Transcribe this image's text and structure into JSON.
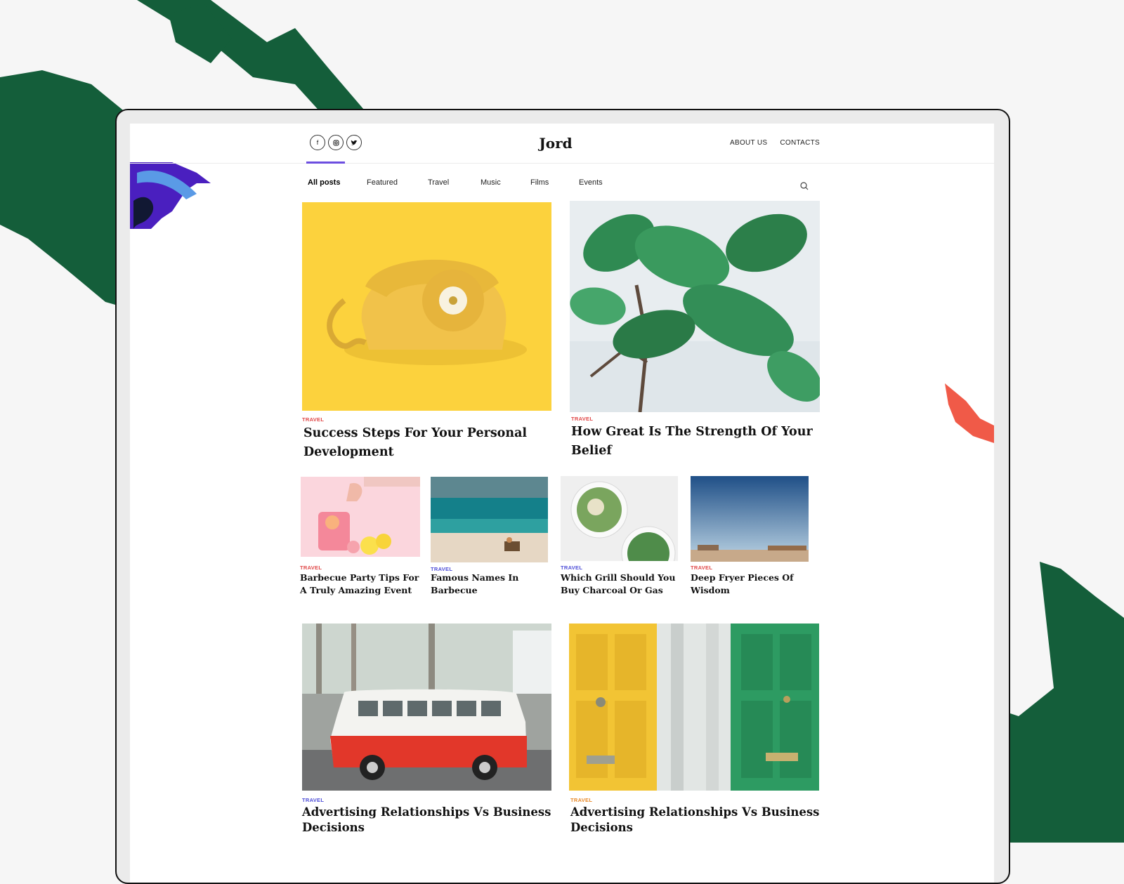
{
  "site": {
    "logo": "Jord",
    "top_links": [
      "ABOUT US",
      "CONTACTS"
    ],
    "social_icons": [
      "facebook-icon",
      "instagram-icon",
      "twitter-icon"
    ]
  },
  "nav": {
    "categories": [
      "All posts",
      "Featured",
      "Travel",
      "Music",
      "Films",
      "Events"
    ],
    "active": "All posts"
  },
  "colors": {
    "brand_green": "#145e3a",
    "accent_purple": "#6c4ee0",
    "tag_red": "#e04848",
    "tag_blue": "#4f4fd8",
    "tag_orange": "#e88a2a"
  },
  "posts": {
    "featured": [
      {
        "tag": "TRAVEL",
        "title_lines": [
          "Success Steps For Your Personal",
          "Development"
        ]
      },
      {
        "tag": "TRAVEL",
        "title_lines": [
          "How Great Is The Strength Of Your",
          "Belief"
        ]
      }
    ],
    "grid": [
      {
        "tag": "TRAVEL",
        "title_lines": [
          "Barbecue Party Tips For",
          "A Truly Amazing Event"
        ]
      },
      {
        "tag": "TRAVEL",
        "title_lines": [
          "Famous Names In",
          "Barbecue"
        ]
      },
      {
        "tag": "TRAVEL",
        "title_lines": [
          "Which Grill Should You",
          "Buy Charcoal Or Gas"
        ]
      },
      {
        "tag": "TRAVEL",
        "title_lines": [
          "Deep Fryer Pieces Of",
          "Wisdom"
        ]
      }
    ],
    "bottom": [
      {
        "tag": "TRAVEL",
        "title_lines": [
          "Advertising Relationships Vs Business",
          "Decisions"
        ]
      },
      {
        "tag": "TRAVEL",
        "title_lines": [
          "Advertising Relationships Vs Business",
          "Decisions"
        ]
      }
    ]
  }
}
